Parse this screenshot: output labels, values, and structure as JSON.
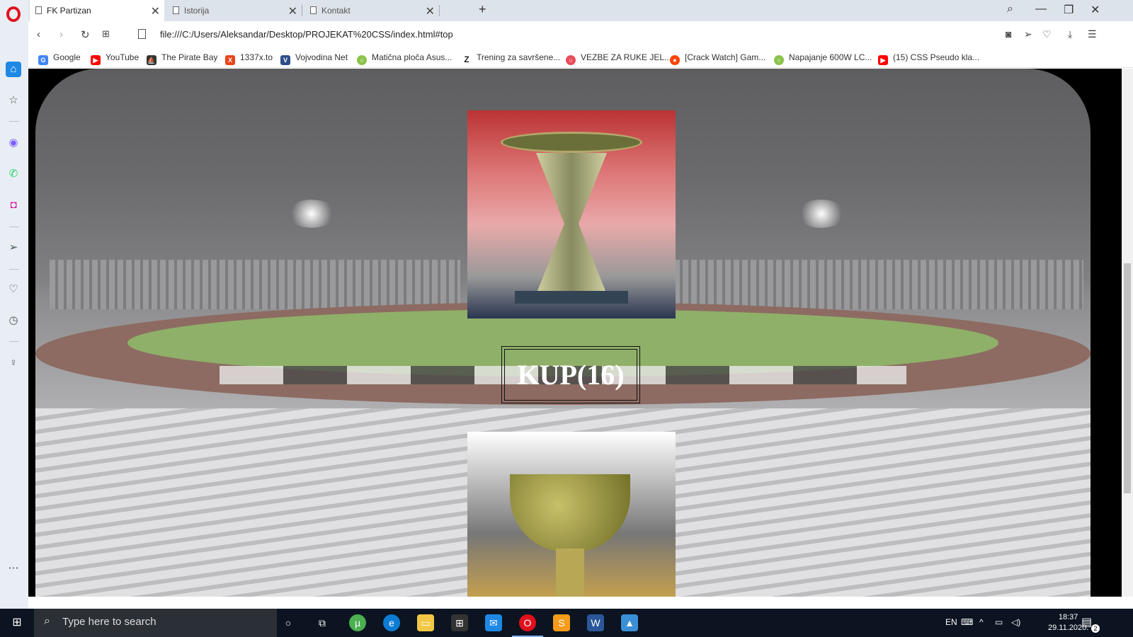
{
  "browser": {
    "tabs": [
      {
        "label": "FK Partizan",
        "active": true
      },
      {
        "label": "Istorija",
        "active": false
      },
      {
        "label": "Kontakt",
        "active": false
      }
    ],
    "url": "file:///C:/Users/Aleksandar/Desktop/PROJEKAT%20CSS/index.html#top",
    "bookmarks": [
      {
        "label": "Google",
        "color": "#4285f4",
        "glyph": "G"
      },
      {
        "label": "YouTube",
        "color": "#ff0000",
        "glyph": "▶"
      },
      {
        "label": "The Pirate Bay",
        "color": "#333333",
        "glyph": "⛵"
      },
      {
        "label": "1337x.to",
        "color": "#e8431b",
        "glyph": "X"
      },
      {
        "label": "Vojvodina Net",
        "color": "#2d4f8a",
        "glyph": "V"
      },
      {
        "label": "Matična ploča Asus...",
        "color": "#8bc34a",
        "glyph": "○"
      },
      {
        "label": "Trening za savršene...",
        "color": "#222222",
        "glyph": "Z"
      },
      {
        "label": "VEZBE ZA RUKE JEL...",
        "color": "#e94b5a",
        "glyph": "○"
      },
      {
        "label": "[Crack Watch] Gam...",
        "color": "#ff4500",
        "glyph": "●"
      },
      {
        "label": "Napajanje 600W LC...",
        "color": "#8bc34a",
        "glyph": "○"
      },
      {
        "label": "(15) CSS Pseudo kla...",
        "color": "#ff0000",
        "glyph": "▶"
      }
    ]
  },
  "page": {
    "heading": "KUP(16)"
  },
  "taskbar": {
    "search_placeholder": "Type here to search",
    "language": "EN",
    "time": "18:37",
    "date": "29.11.2020.",
    "notifications": "2"
  }
}
